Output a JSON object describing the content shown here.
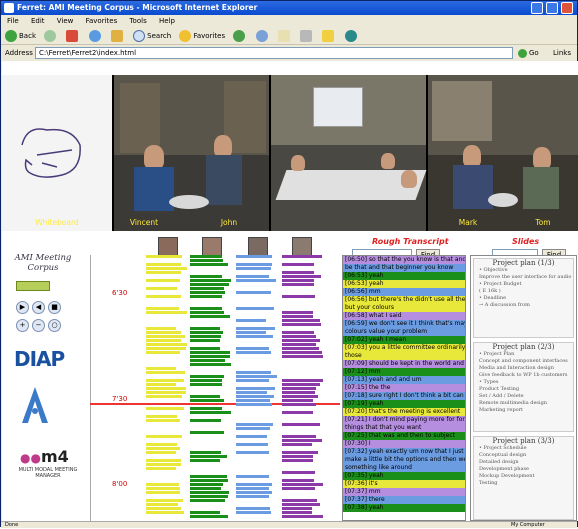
{
  "window": {
    "title": "Ferret: AMI Meeting Corpus - Microsoft Internet Explorer"
  },
  "menu": [
    "File",
    "Edit",
    "View",
    "Favorites",
    "Tools",
    "Help"
  ],
  "toolbar": {
    "back": "Back",
    "search": "Search",
    "favorites": "Favorites"
  },
  "address": {
    "label": "Address",
    "value": "C:\\Ferret\\Ferret2\\index.html",
    "go": "Go",
    "links": "Links"
  },
  "video": {
    "captions": [
      "Whiteboard",
      "Vincent",
      "John",
      "Mark",
      "Tom"
    ]
  },
  "left_panel": {
    "corpus_title": "AMI Meeting Corpus",
    "logo_diap": "DIAP",
    "logo_m4": "m4",
    "logo_m4_sub": "MULTI MODAL MEETING MANAGER"
  },
  "timeline": {
    "time_labels": [
      "6'30",
      "7'30",
      "8'00"
    ],
    "colors": [
      "#e8e83a",
      "#1a8f1a",
      "#6b9be0",
      "#8b3aa8"
    ]
  },
  "transcript": {
    "header": "Rough Transcript",
    "find": "Find",
    "rows": [
      {
        "t": "[06:50] so that the you know is that and our that here",
        "c": "#b58ee0"
      },
      {
        "t": "be that and that beginner you know",
        "c": "#6b9be0"
      },
      {
        "t": "[06:53] yeah",
        "c": "#1a8f1a"
      },
      {
        "t": "[06:53] yeah",
        "c": "#e8e83a"
      },
      {
        "t": "[06:56] mm",
        "c": "#6b9be0"
      },
      {
        "t": "[06:56] but there's the didn't use all the ends of that",
        "c": "#e8e83a"
      },
      {
        "t": "but your colours",
        "c": "#e8e83a"
      },
      {
        "t": "[06:58] what I said",
        "c": "#b58ee0"
      },
      {
        "t": "[06:59] we don't see it I think that's maybe the other",
        "c": "#6b9be0"
      },
      {
        "t": "colours value your problem",
        "c": "#6b9be0"
      },
      {
        "t": "[07:02] yeah I mean",
        "c": "#1a8f1a"
      },
      {
        "t": "[07:03] you a little committee ordinarily quickly to say",
        "c": "#e8e83a"
      },
      {
        "t": "those",
        "c": "#e8e83a"
      },
      {
        "t": "[07:09] should be kept in the world and it's not your",
        "c": "#b58ee0"
      },
      {
        "t": "[07:12] mm",
        "c": "#1a8f1a"
      },
      {
        "t": "[07:13] yeah and and um",
        "c": "#6b9be0"
      },
      {
        "t": "[07:15] the the",
        "c": "#b58ee0"
      },
      {
        "t": "[07:18] sure right I don't think a bit can call",
        "c": "#6b9be0"
      },
      {
        "t": "[07:19] yeah",
        "c": "#1a8f1a"
      },
      {
        "t": "[07:20] that's the meeting is excellent",
        "c": "#e8e83a"
      },
      {
        "t": "[07:21] I don't mind paying more for for example",
        "c": "#b58ee0"
      },
      {
        "t": "things that that you want",
        "c": "#b58ee0"
      },
      {
        "t": "[07:25] that was and then to subject",
        "c": "#1a8f1a"
      },
      {
        "t": "[07:30] I",
        "c": "#b58ee0"
      },
      {
        "t": "[07:32] yeah exactly um now that I just session",
        "c": "#6b9be0"
      },
      {
        "t": "make a little bit the options and then we need",
        "c": "#6b9be0"
      },
      {
        "t": "something like around",
        "c": "#6b9be0"
      },
      {
        "t": "[07:35] yeah",
        "c": "#1a8f1a"
      },
      {
        "t": "[07:36] it's",
        "c": "#e8e83a"
      },
      {
        "t": "[07:37] mm",
        "c": "#b58ee0"
      },
      {
        "t": "[07:37] there",
        "c": "#6b9be0"
      },
      {
        "t": "[07:38] yeah",
        "c": "#1a8f1a"
      }
    ]
  },
  "slides": {
    "header": "Slides",
    "find": "Find",
    "items": [
      {
        "title": "Project plan (1/3)",
        "lines": [
          "• Objective",
          "   Improve the user interface for audio (AV)",
          "• Project Budget",
          "   ( E 16k )",
          "• Deadline",
          "   → A discussion from"
        ]
      },
      {
        "title": "Project plan (2/3)",
        "lines": [
          "• Project Plan",
          "   Concept and component interfaces",
          "   Media and Interaction design",
          "   Give feedback to WP 1b customers",
          "• Types",
          "   Product Testing",
          "   Set / Add / Delete",
          "   Remote multimedia design",
          "   Marketing report"
        ]
      },
      {
        "title": "Project plan (3/3)",
        "lines": [
          "• Project Schedule",
          "   Conceptual design",
          "   Detailed design",
          "   Development phase",
          "   Mockup Development",
          "   Testing"
        ]
      }
    ]
  },
  "status": {
    "text": "Done",
    "zone": "My Computer"
  }
}
